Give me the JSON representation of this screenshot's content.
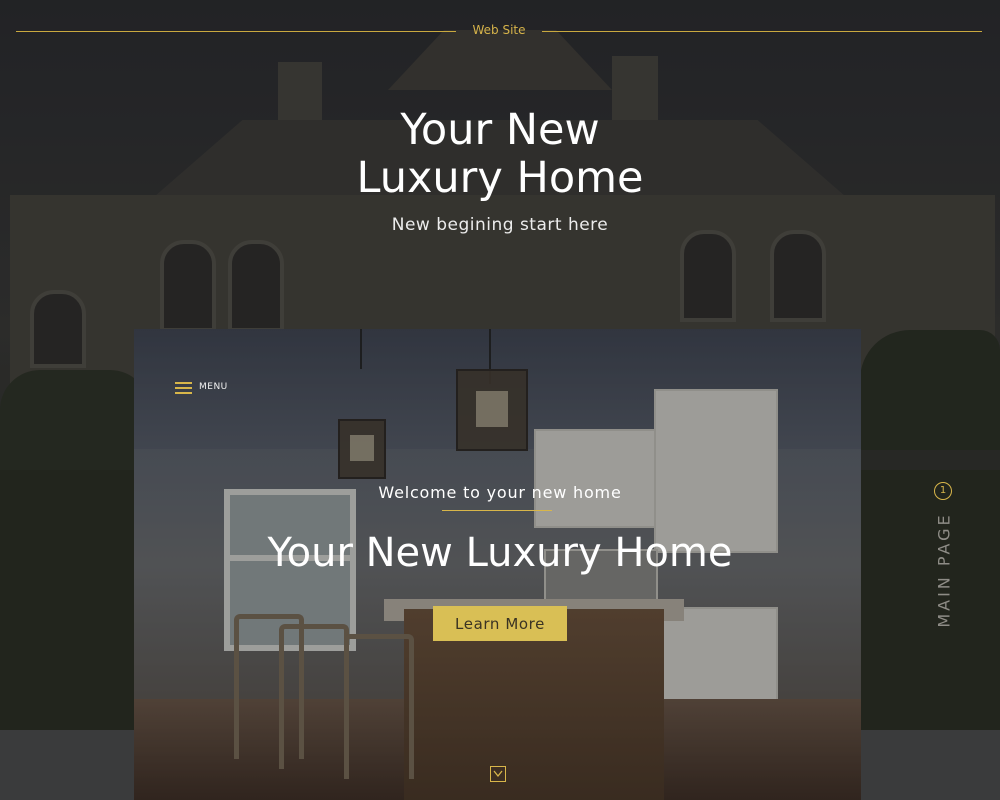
{
  "header": {
    "site_label": "Web Site"
  },
  "hero": {
    "title_line1": "Your New",
    "title_line2": "Luxury Home",
    "subtitle": "New begining start here"
  },
  "preview": {
    "menu_label": "MENU",
    "welcome": "Welcome to your new home",
    "title": "Your New Luxury Home",
    "cta_label": "Learn More"
  },
  "side_nav": {
    "page_number": "1",
    "page_label": "MAIN PAGE"
  },
  "colors": {
    "accent": "#d9bf55",
    "background": "#2a2b2d",
    "text": "#ffffff"
  },
  "icons": {
    "menu": "hamburger-icon",
    "scroll": "chevron-down-icon"
  }
}
